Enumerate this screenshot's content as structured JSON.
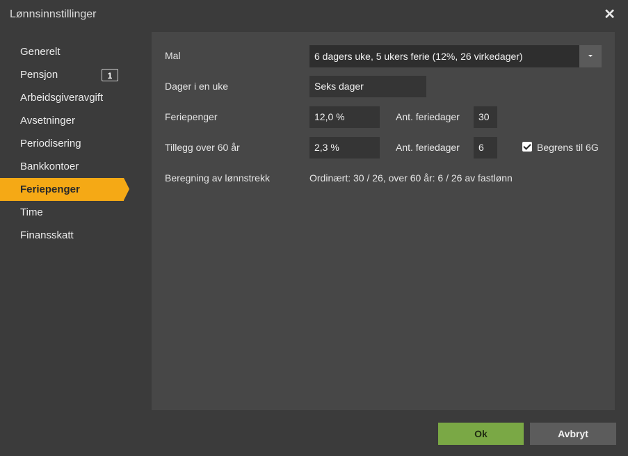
{
  "window": {
    "title": "Lønnsinnstillinger"
  },
  "sidebar": {
    "items": [
      {
        "label": "Generelt"
      },
      {
        "label": "Pensjon",
        "badge": "1"
      },
      {
        "label": "Arbeidsgiveravgift"
      },
      {
        "label": "Avsetninger"
      },
      {
        "label": "Periodisering"
      },
      {
        "label": "Bankkontoer"
      },
      {
        "label": "Feriepenger",
        "active": true
      },
      {
        "label": "Time"
      },
      {
        "label": "Finansskatt"
      }
    ]
  },
  "form": {
    "mal_label": "Mal",
    "mal_value": "6 dagers uke, 5 ukers ferie (12%, 26 virkedager)",
    "dager_label": "Dager i en uke",
    "dager_value": "Seks dager",
    "feriepenger_label": "Feriepenger",
    "feriepenger_value": "12,0 %",
    "ant_label_1": "Ant. feriedager",
    "ant_value_1": "30",
    "tillegg_label": "Tillegg over 60 år",
    "tillegg_value": "2,3 %",
    "ant_label_2": "Ant. feriedager",
    "ant_value_2": "6",
    "begrens_label": "Begrens til 6G",
    "begrens_checked": true,
    "beregning_label": "Beregning av lønnstrekk",
    "beregning_value": "Ordinært: 30 / 26, over 60 år: 6 / 26 av fastlønn"
  },
  "footer": {
    "ok_label": "Ok",
    "cancel_label": "Avbryt"
  },
  "colors": {
    "accent": "#f5a915",
    "ok": "#7aa845",
    "panel": "#474747"
  }
}
